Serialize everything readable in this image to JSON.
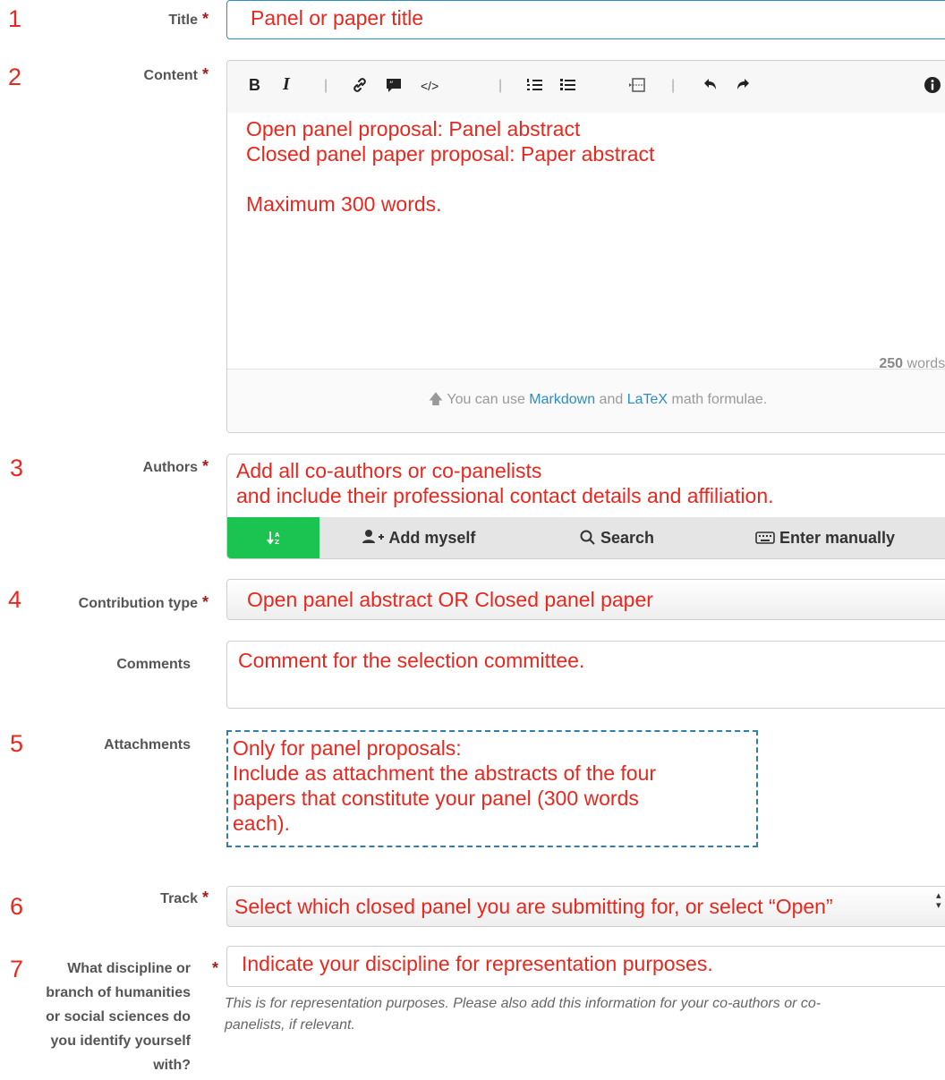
{
  "markers": [
    "1",
    "2",
    "3",
    "4",
    "5",
    "6",
    "7"
  ],
  "required_mark": "*",
  "fields": {
    "title": {
      "label": "Title",
      "value": "Panel or paper title"
    },
    "content": {
      "label": "Content",
      "toolbar": {
        "bold": "B",
        "italic": "I",
        "sep": "|"
      },
      "lines": [
        "Open panel proposal: Panel abstract",
        "Closed panel paper proposal: Paper abstract",
        "",
        "Maximum 300 words."
      ],
      "words_count": "250",
      "words_suffix": " words left",
      "footer_prefix": "You can use ",
      "footer_link1": "Markdown",
      "footer_mid": " and ",
      "footer_link2": "LaTeX",
      "footer_suffix": " math formulae."
    },
    "authors": {
      "label": "Authors",
      "lines": [
        "Add all co-authors or co-panelists",
        "and include their professional contact details and affiliation."
      ],
      "add_myself": "Add myself",
      "search": "Search",
      "enter_manually": "Enter manually"
    },
    "contribution_type": {
      "label": "Contribution type",
      "value": "Open panel abstract OR Closed panel paper"
    },
    "comments": {
      "label": "Comments",
      "value": "Comment for the selection committee."
    },
    "attachments": {
      "label": "Attachments",
      "lines": [
        "Only for panel proposals:",
        "Include as attachment the abstracts of the four",
        "papers that constitute your panel (300 words",
        "each)."
      ]
    },
    "track": {
      "label": "Track",
      "value": "Select which closed panel you are submitting for, or select “Open”"
    },
    "discipline": {
      "label_lines": [
        "What discipline or",
        "branch of humanities",
        "or social sciences do",
        "you identify yourself",
        "with?"
      ],
      "value": "Indicate your discipline for representation purposes.",
      "help": "This is for representation purposes. Please also add this information for your co-authors or co-panelists, if relevant."
    }
  },
  "colors": {
    "annotation_red": "#e8281e",
    "accent_blue": "#2b8ec6",
    "sort_green": "#1bc451"
  }
}
